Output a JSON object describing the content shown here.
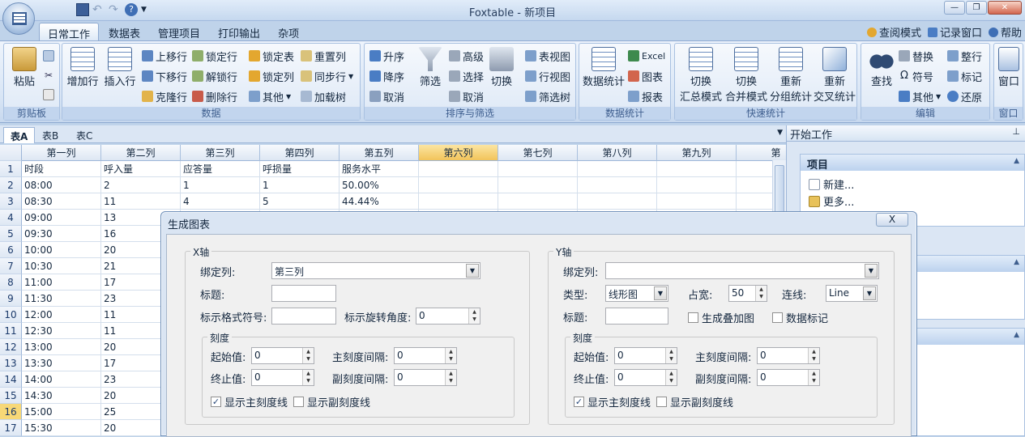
{
  "app": {
    "title": "Foxtable - 新项目"
  },
  "tabs": [
    "日常工作",
    "数据表",
    "管理项目",
    "打印输出",
    "杂项"
  ],
  "rightlinks": [
    "查阅模式",
    "记录窗口",
    "帮助"
  ],
  "ribbon": {
    "clipboard": {
      "label": "剪贴板",
      "paste": "粘贴"
    },
    "data": {
      "label": "数据",
      "add_row": "增加行",
      "insert_row": "插入行",
      "move_up": "上移行",
      "move_down": "下移行",
      "clone_row": "克隆行",
      "lock_row": "锁定行",
      "unlock_row": "解锁行",
      "delete_row": "删除行",
      "lock_table": "锁定表",
      "lock_col": "锁定列",
      "other": "其他",
      "reset_col": "重置列",
      "sync_row": "同步行",
      "load_tree": "加载树"
    },
    "sort": {
      "label": "排序与筛选",
      "asc": "升序",
      "desc": "降序",
      "cancel": "取消",
      "filter": "筛选",
      "advanced": "高级",
      "select": "选择",
      "cancel2": "取消",
      "toggle": "切换",
      "table_view": "表视图",
      "row_view": "行视图",
      "filter_tree": "筛选树"
    },
    "stats": {
      "label": "数据统计",
      "data_stats": "数据统计",
      "excel": "Excel",
      "chart": "图表",
      "report": "报表"
    },
    "quick": {
      "label": "快速统计",
      "summary": [
        "切换",
        "汇总模式"
      ],
      "merge": [
        "切换",
        "合并模式"
      ],
      "regroup": [
        "重新",
        "分组统计"
      ],
      "recross": [
        "重新",
        "交叉统计"
      ]
    },
    "edit": {
      "label": "编辑",
      "find": "查找",
      "replace": "替换",
      "symbol": "符号",
      "other": "其他",
      "tidy": "整行",
      "mark": "标记",
      "restore": "还原"
    },
    "window": {
      "label": "窗口",
      "window": "窗口"
    }
  },
  "sheet_tabs": [
    "表A",
    "表B",
    "表C"
  ],
  "grid": {
    "columns": [
      "第一列",
      "第二列",
      "第三列",
      "第四列",
      "第五列",
      "第六列",
      "第七列",
      "第八列",
      "第九列",
      "第"
    ],
    "selected_col": 5,
    "rows": [
      {
        "n": "1",
        "c": [
          "时段",
          "呼入量",
          "应答量",
          "呼损量",
          "服务水平"
        ]
      },
      {
        "n": "2",
        "c": [
          "08:00",
          "2",
          "1",
          "1",
          "50.00%"
        ]
      },
      {
        "n": "3",
        "c": [
          "08:30",
          "11",
          "4",
          "5",
          "44.44%"
        ]
      },
      {
        "n": "4",
        "c": [
          "09:00",
          "13",
          "",
          "",
          ""
        ]
      },
      {
        "n": "5",
        "c": [
          "09:30",
          "16",
          "",
          "",
          ""
        ]
      },
      {
        "n": "6",
        "c": [
          "10:00",
          "20",
          "",
          "",
          ""
        ]
      },
      {
        "n": "7",
        "c": [
          "10:30",
          "21",
          "",
          "",
          ""
        ]
      },
      {
        "n": "8",
        "c": [
          "11:00",
          "17",
          "",
          "",
          ""
        ]
      },
      {
        "n": "9",
        "c": [
          "11:30",
          "23",
          "",
          "",
          ""
        ]
      },
      {
        "n": "10",
        "c": [
          "12:00",
          "11",
          "",
          "",
          ""
        ]
      },
      {
        "n": "11",
        "c": [
          "12:30",
          "11",
          "",
          "",
          ""
        ]
      },
      {
        "n": "12",
        "c": [
          "13:00",
          "20",
          "",
          "",
          ""
        ]
      },
      {
        "n": "13",
        "c": [
          "13:30",
          "17",
          "",
          "",
          ""
        ]
      },
      {
        "n": "14",
        "c": [
          "14:00",
          "23",
          "",
          "",
          ""
        ]
      },
      {
        "n": "15",
        "c": [
          "14:30",
          "20",
          "",
          "",
          ""
        ]
      },
      {
        "n": "16",
        "c": [
          "15:00",
          "25",
          "",
          "",
          ""
        ]
      },
      {
        "n": "17",
        "c": [
          "15:30",
          "20",
          "",
          "",
          ""
        ]
      }
    ]
  },
  "panel": {
    "title": "开始工作",
    "section": "项目",
    "items": [
      "新建...",
      "更多..."
    ]
  },
  "dialog": {
    "title": "生成图表",
    "close": "X",
    "x": {
      "group": "X轴",
      "bind_label": "绑定列:",
      "bind_value": "第三列",
      "title_label": "标题:",
      "title_value": "",
      "format_label": "标示格式符号:",
      "format_value": "",
      "rotate_label": "标示旋转角度:",
      "rotate_value": "0",
      "scale": {
        "group": "刻度",
        "start_label": "起始值:",
        "start": "0",
        "end_label": "终止值:",
        "end": "0",
        "major_label": "主刻度间隔:",
        "major": "0",
        "minor_label": "副刻度间隔:",
        "minor": "0",
        "show_major": "显示主刻度线",
        "show_minor": "显示副刻度线"
      }
    },
    "y": {
      "group": "Y轴",
      "bind_label": "绑定列:",
      "bind_value": "",
      "type_label": "类型:",
      "type_value": "线形图",
      "width_label": "占宽:",
      "width_value": "50",
      "line_label": "连线:",
      "line_value": "Line",
      "title_label": "标题:",
      "title_value": "",
      "stack": "生成叠加图",
      "marker": "数据标记",
      "scale": {
        "group": "刻度",
        "start_label": "起始值:",
        "start": "0",
        "end_label": "终止值:",
        "end": "0",
        "major_label": "主刻度间隔:",
        "major": "0",
        "minor_label": "副刻度间隔:",
        "minor": "0",
        "show_major": "显示主刻度线",
        "show_minor": "显示副刻度线"
      }
    }
  }
}
